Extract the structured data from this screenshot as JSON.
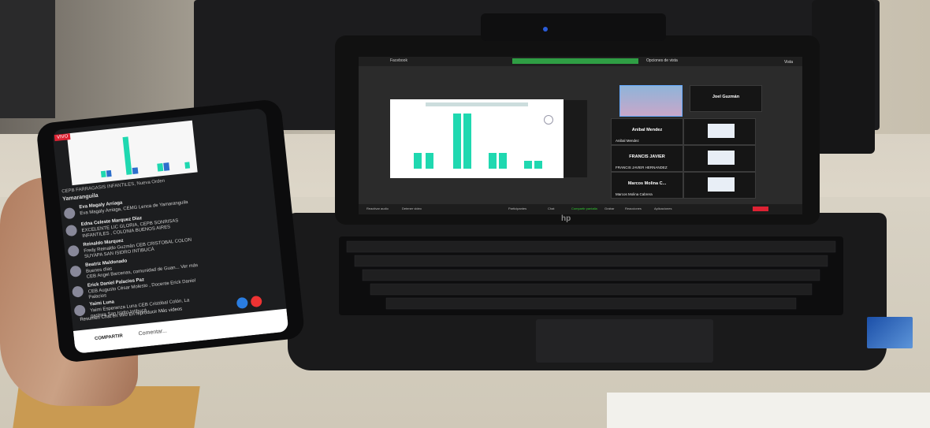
{
  "laptop": {
    "brand": "hp",
    "meeting": {
      "rec_label": "",
      "facebook_label": "Facebook",
      "options_label": "Opciones de vista",
      "view_label": "Vista",
      "share_title": "",
      "participants": [
        {
          "name": "Joel Guzmán",
          "sub": "Joel Guzmán"
        },
        {
          "name": "Anibal Mendez",
          "sub": "Anibal Mendez"
        },
        {
          "name": "FRANCIS JAVIER",
          "sub": "FRANCIS JAVIER HERNANDEZ"
        },
        {
          "name": "Marcos Molina C...",
          "sub": "Marcos Molina Cabrera"
        }
      ],
      "toolbar": [
        "Reactivar audio",
        "Detener video",
        "Participantes",
        "Chat",
        "Compartir pantalla",
        "Grabar",
        "Reacciones",
        "Aplicaciones",
        "Salir"
      ]
    }
  },
  "phone": {
    "live_label": "VIVO",
    "caption_top": "CEPB FARRAGASIS INFANTILES, Nueva Orden",
    "caption_name": "Yamaranguila",
    "comments": [
      {
        "name": "Eva Magaly Arriaga",
        "text": "Eva Magaly Arriaga, CEMG Lenca de Yamaranguila",
        "text2": ""
      },
      {
        "name": "Edna Celeste Marquez Diaz",
        "text": "EXCELENTE LIC GLORIA, CEPB SONRISAS",
        "text2": "INFANTILES , COLONIA BUENOS AIRES"
      },
      {
        "name": "Reinaldo Marquez",
        "text": "Fredy Reinaldo Guzmán CEB CRISTOBAL COLON",
        "text2": "SUYAPA SAN ISIDRO INTIBUCÁ"
      },
      {
        "name": "Beatriz Maldonado",
        "text": "Buenos días",
        "text2": "CEB Angel Barcenas, comunidad de Guan... Ver más"
      },
      {
        "name": "Erick Daniel Palacios Paz",
        "text": "CEB Augusto César Molesto , Docente Erick Daniel",
        "text2": "Palacios"
      },
      {
        "name": "Yaimi Luna",
        "text": "Yaimi Esperanza Luna CEB Cristóbal Colón, La",
        "text2": "pastora San Isidro Intibucá"
      }
    ],
    "tabs": "Resumen    Chat en vivo    En reproducir    Más videos",
    "share_label": "COMPARTIR",
    "comment_placeholder": "Comentar..."
  },
  "accent_colors": {
    "chart_bar": "#1fd8b0",
    "live_red": "#dd2233",
    "zoom_green": "#2f9e44"
  }
}
